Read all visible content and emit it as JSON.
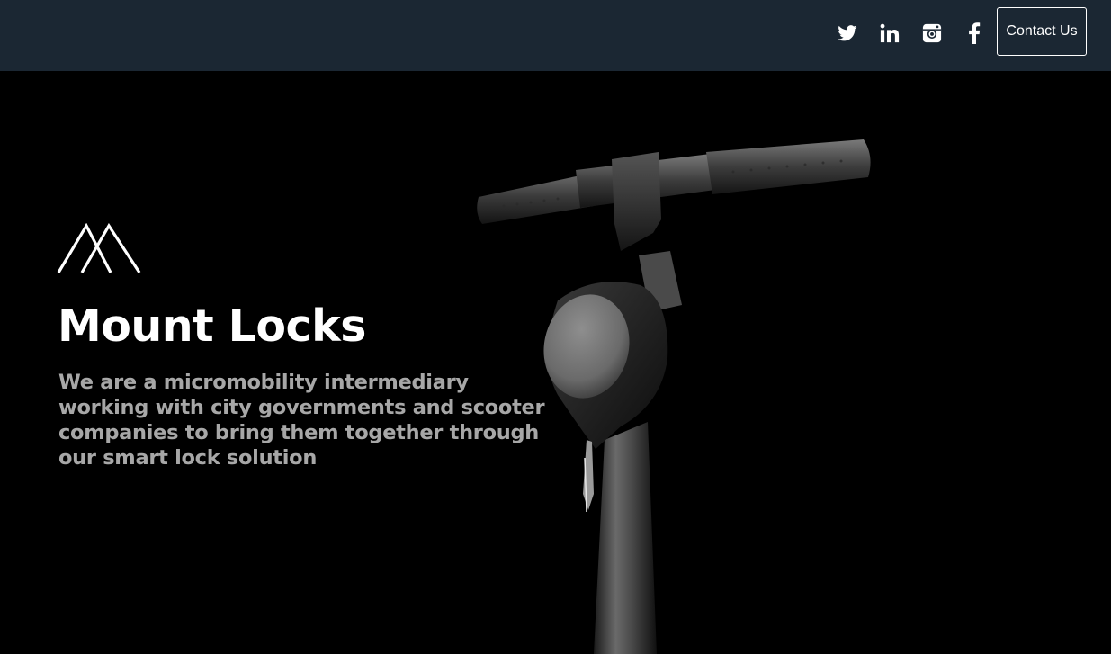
{
  "header": {
    "social": [
      {
        "icon": "twitter-icon",
        "label": "Twitter"
      },
      {
        "icon": "linkedin-icon",
        "label": "LinkedIn"
      },
      {
        "icon": "instagram-icon",
        "label": "Instagram"
      },
      {
        "icon": "facebook-icon",
        "label": "Facebook"
      }
    ],
    "contact_label": "Contact Us"
  },
  "hero": {
    "title": "Mount Locks",
    "tagline": "We are a micromobility intermediary working with city governments and scooter companies to bring them together through our smart lock solution"
  },
  "colors": {
    "header_bg": "#1b2733",
    "hero_bg": "#000000",
    "title": "#ffffff",
    "tagline": "#a7a7a7"
  }
}
